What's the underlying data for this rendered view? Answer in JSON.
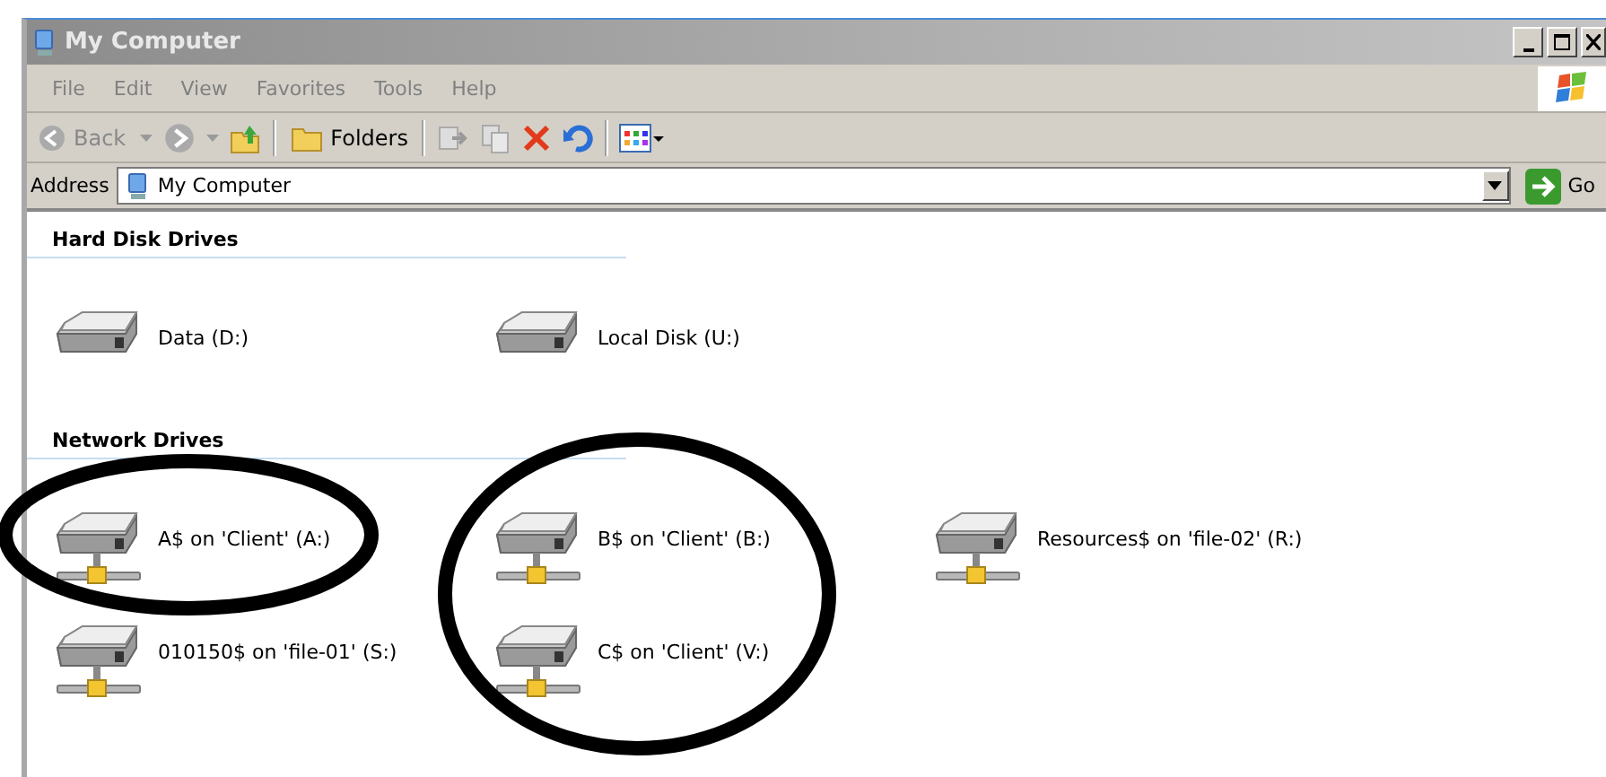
{
  "window": {
    "title": "My Computer",
    "active": false
  },
  "menu": [
    "File",
    "Edit",
    "View",
    "Favorites",
    "Tools",
    "Help"
  ],
  "toolbar": {
    "back": "Back",
    "folders": "Folders"
  },
  "address": {
    "label": "Address",
    "value": "My Computer",
    "go": "Go"
  },
  "groups": [
    {
      "title": "Hard Disk Drives",
      "items": [
        {
          "label": "Data (D:)",
          "kind": "local"
        },
        {
          "label": "Local Disk (U:)",
          "kind": "local"
        }
      ]
    },
    {
      "title": "Network Drives",
      "items": [
        {
          "label": "A$ on 'Client' (A:)",
          "kind": "network"
        },
        {
          "label": "B$ on 'Client' (B:)",
          "kind": "network"
        },
        {
          "label": "Resources$ on 'file-02' (R:)",
          "kind": "network"
        },
        {
          "label": "010150$ on 'file-01' (S:)",
          "kind": "network"
        },
        {
          "label": "C$ on 'Client' (V:)",
          "kind": "network"
        }
      ]
    }
  ]
}
